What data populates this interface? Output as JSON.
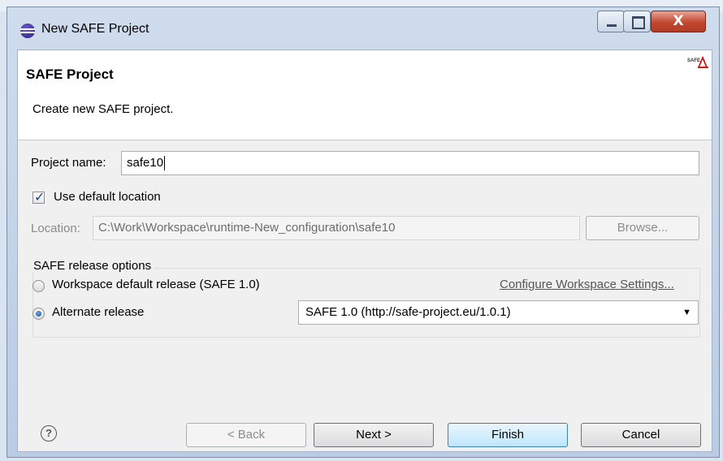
{
  "window": {
    "title": "New SAFE Project"
  },
  "header": {
    "title": "SAFE Project",
    "description": "Create new SAFE project.",
    "logo_text": "SAFE"
  },
  "form": {
    "project_name_label": "Project name:",
    "project_name_value": "safe10",
    "use_default_location_label": "Use default location",
    "use_default_location_checked": true,
    "location_label": "Location:",
    "location_value": "C:\\Work\\Workspace\\runtime-New_configuration\\safe10",
    "browse_label": "Browse..."
  },
  "release_options": {
    "group_title": "SAFE release options",
    "workspace_default_label": "Workspace default release (SAFE 1.0)",
    "configure_link": "Configure Workspace Settings...",
    "alternate_label": "Alternate release",
    "selected_option": "alternate",
    "alternate_value": "SAFE 1.0 (http://safe-project.eu/1.0.1)"
  },
  "buttons": {
    "back": "< Back",
    "next": "Next >",
    "finish": "Finish",
    "cancel": "Cancel"
  },
  "colors": {
    "accent": "#3c7fb1",
    "close_button": "#c2472f",
    "logo_red": "#d40000"
  }
}
